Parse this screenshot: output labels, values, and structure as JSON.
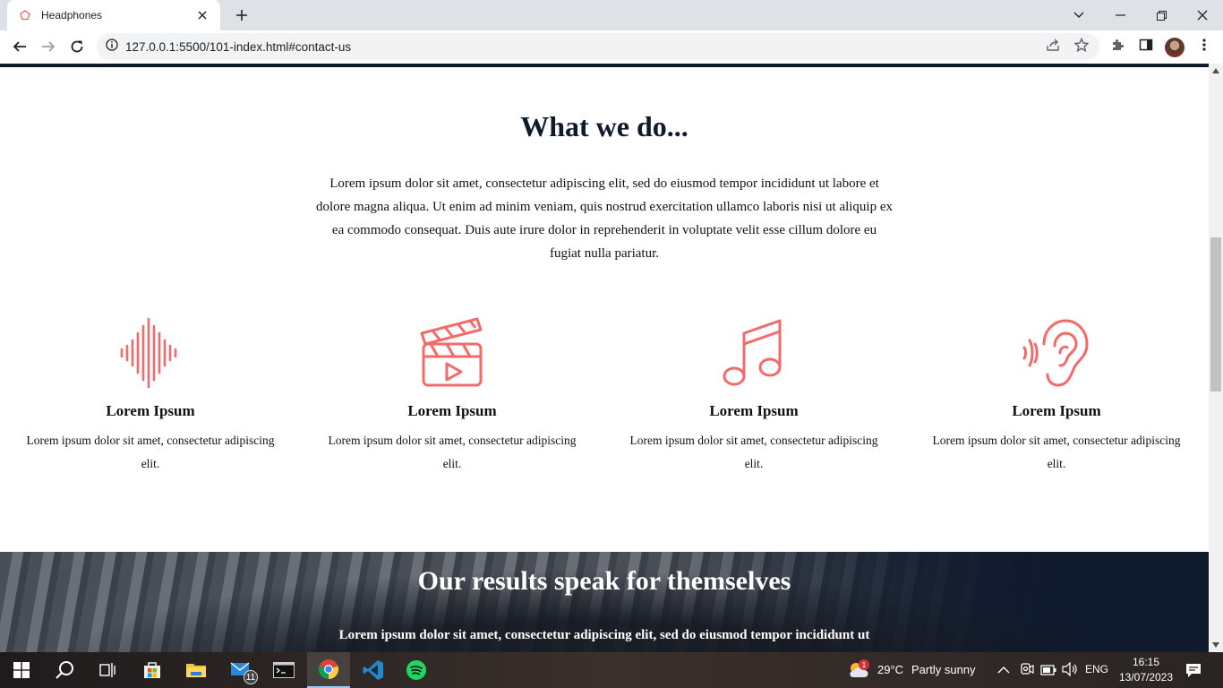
{
  "browser": {
    "tab_title": "Headphones",
    "url": "127.0.0.1:5500/101-index.html#contact-us"
  },
  "page": {
    "heading": "What we do...",
    "intro": "Lorem ipsum dolor sit amet, consectetur adipiscing elit, sed do eiusmod tempor incididunt ut labore et dolore magna aliqua. Ut enim ad minim veniam, quis nostrud exercitation ullamco laboris nisi ut aliquip ex ea commodo consequat. Duis aute irure dolor in reprehenderit in voluptate velit esse cillum dolore eu fugiat nulla pariatur.",
    "features": [
      {
        "icon": "sound-wave-icon",
        "title": "Lorem Ipsum",
        "desc": "Lorem ipsum dolor sit amet, consectetur adipiscing elit."
      },
      {
        "icon": "clapperboard-icon",
        "title": "Lorem Ipsum",
        "desc": "Lorem ipsum dolor sit amet, consectetur adipiscing elit."
      },
      {
        "icon": "music-note-icon",
        "title": "Lorem Ipsum",
        "desc": "Lorem ipsum dolor sit amet, consectetur adipiscing elit."
      },
      {
        "icon": "ear-icon",
        "title": "Lorem Ipsum",
        "desc": "Lorem ipsum dolor sit amet, consectetur adipiscing elit."
      }
    ],
    "results": {
      "title": "Our results speak for themselves",
      "text": "Lorem ipsum dolor sit amet, consectetur adipiscing elit, sed do eiusmod tempor incididunt ut"
    },
    "accent_color": "#f36a6a",
    "heading_color": "#0f1a2c"
  },
  "taskbar": {
    "mail_badge": "11",
    "weather_temp": "29°C",
    "weather_text": "Partly sunny",
    "weather_badge": "1",
    "language": "ENG",
    "time": "16:15",
    "date": "13/07/2023"
  }
}
